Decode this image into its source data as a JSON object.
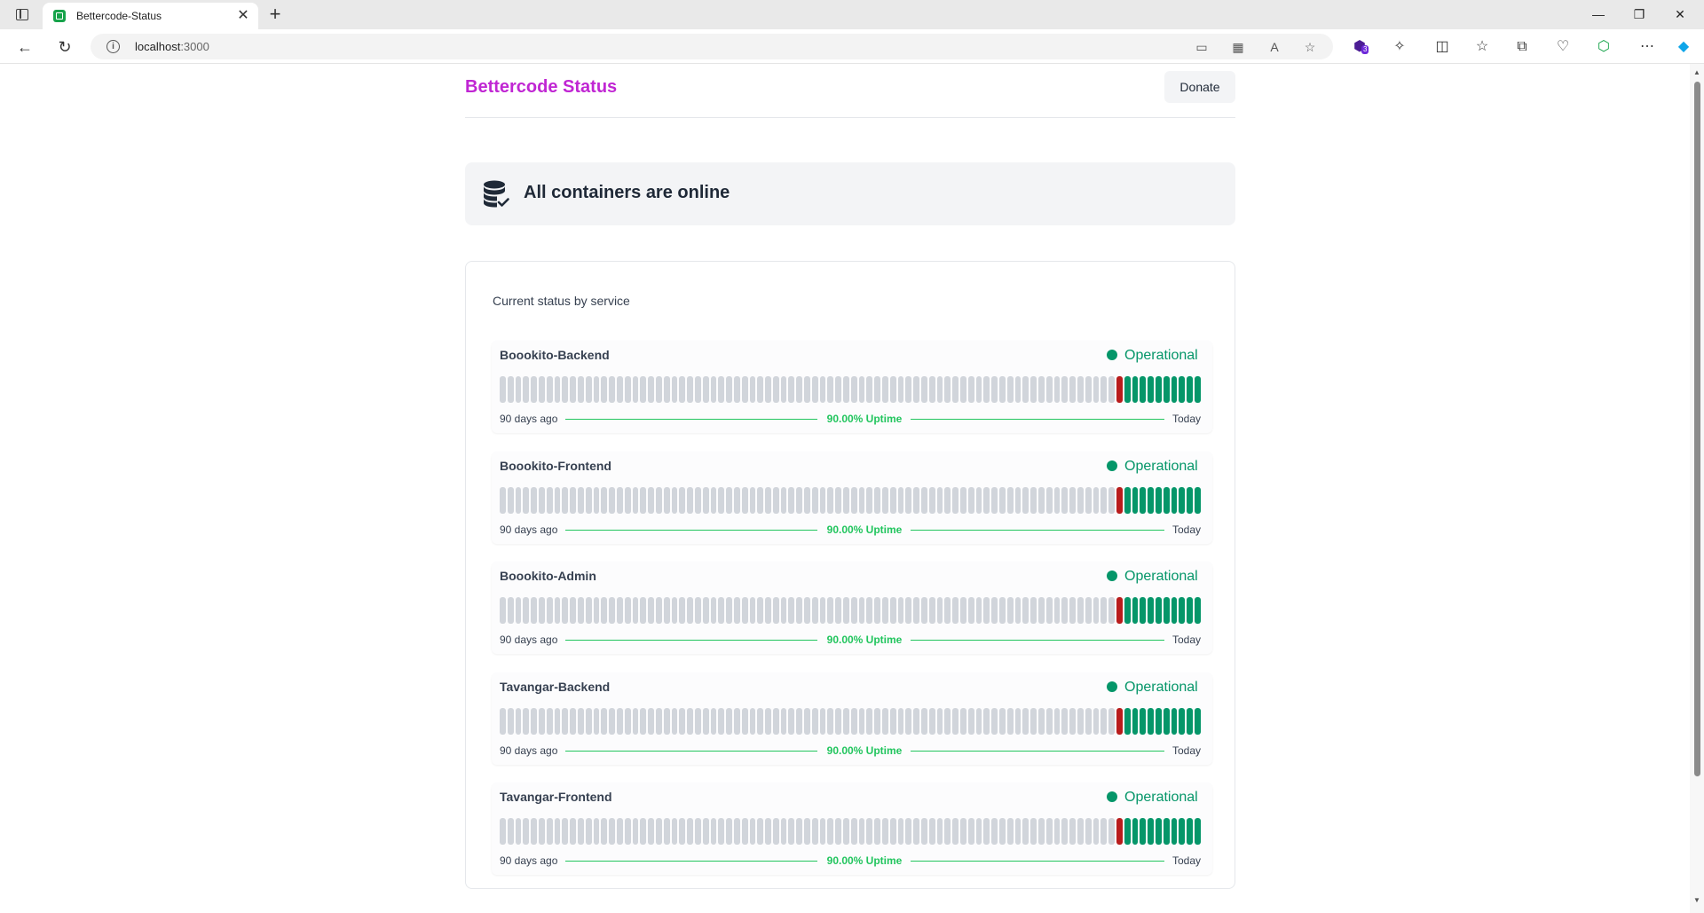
{
  "browser": {
    "tab_title": "Bettercode-Status",
    "url_host": "localhost",
    "url_port": ":3000",
    "extension_badge": "3"
  },
  "header": {
    "brand": "Bettercode Status",
    "donate_label": "Donate"
  },
  "banner": {
    "text": "All containers are online"
  },
  "card": {
    "title": "Current status by service"
  },
  "bar_legend": {
    "total_days": 90,
    "unknown_days": 79,
    "down_days": 1,
    "up_days": 10,
    "colors": {
      "unknown": "#d1d5db",
      "down": "#b91c1c",
      "up": "#059669"
    }
  },
  "services": [
    {
      "name": "Boookito-Backend",
      "status": "Operational",
      "left_label": "90 days ago",
      "uptime": "90.00% Uptime",
      "right_label": "Today"
    },
    {
      "name": "Boookito-Frontend",
      "status": "Operational",
      "left_label": "90 days ago",
      "uptime": "90.00% Uptime",
      "right_label": "Today"
    },
    {
      "name": "Boookito-Admin",
      "status": "Operational",
      "left_label": "90 days ago",
      "uptime": "90.00% Uptime",
      "right_label": "Today"
    },
    {
      "name": "Tavangar-Backend",
      "status": "Operational",
      "left_label": "90 days ago",
      "uptime": "90.00% Uptime",
      "right_label": "Today"
    },
    {
      "name": "Tavangar-Frontend",
      "status": "Operational",
      "left_label": "90 days ago",
      "uptime": "90.00% Uptime",
      "right_label": "Today"
    }
  ],
  "colors": {
    "brand": "#c026d3",
    "operational": "#059669",
    "uptime": "#22c55e"
  }
}
